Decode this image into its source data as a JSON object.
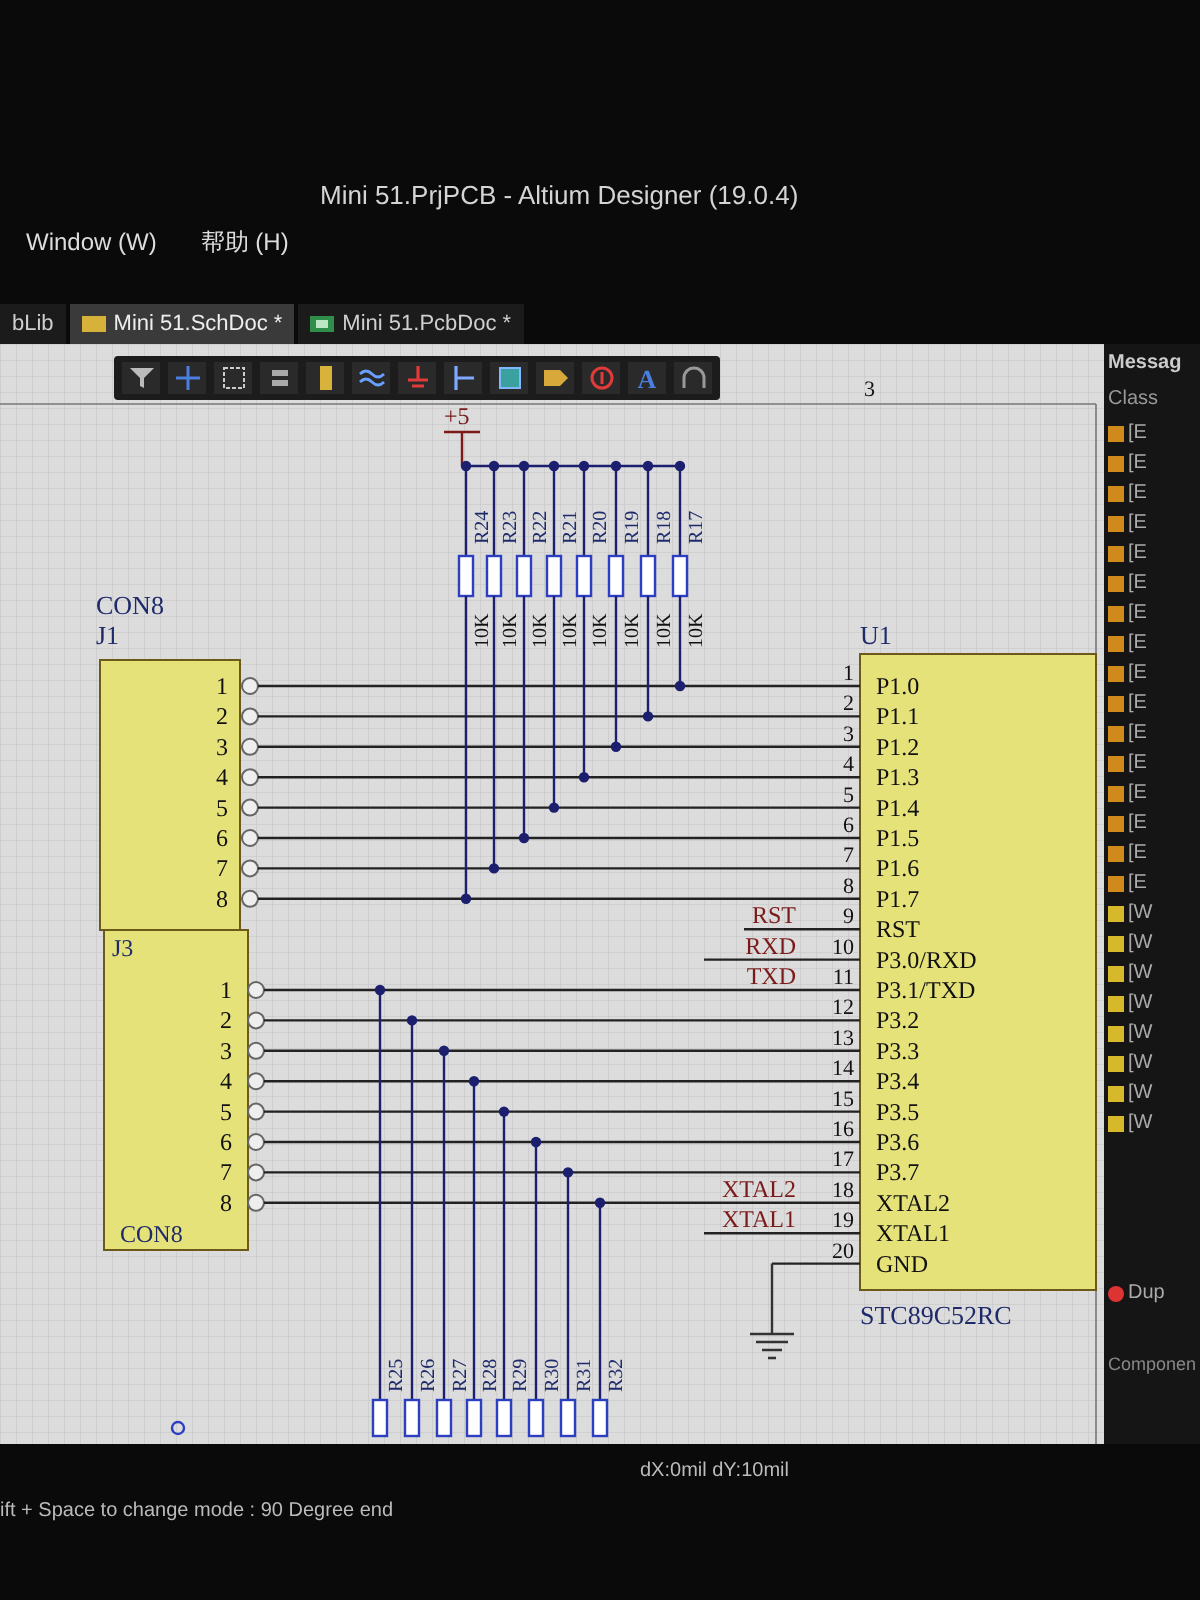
{
  "window": {
    "title": "Mini 51.PrjPCB - Altium Designer (19.0.4)"
  },
  "menu": [
    {
      "label": "Window (W)"
    },
    {
      "label": "帮助 (H)"
    }
  ],
  "tabs": [
    {
      "label": "bLib",
      "kind": "lib",
      "selected": false
    },
    {
      "label": "Mini 51.SchDoc *",
      "kind": "sch",
      "selected": true
    },
    {
      "label": "Mini 51.PcbDoc *",
      "kind": "pcb",
      "selected": false
    }
  ],
  "toolbar": [
    {
      "kind": "filter"
    },
    {
      "kind": "cross"
    },
    {
      "kind": "select"
    },
    {
      "kind": "align"
    },
    {
      "kind": "part"
    },
    {
      "kind": "bus"
    },
    {
      "kind": "power"
    },
    {
      "kind": "port"
    },
    {
      "kind": "sheet"
    },
    {
      "kind": "harness"
    },
    {
      "kind": "noerc"
    },
    {
      "kind": "text",
      "label": "A"
    },
    {
      "kind": "arc"
    }
  ],
  "schematic": {
    "zone_label": "3",
    "power_port": {
      "label": "+5"
    },
    "pullup_resistors": [
      {
        "designator": "R24",
        "value": "10K"
      },
      {
        "designator": "R23",
        "value": "10K"
      },
      {
        "designator": "R22",
        "value": "10K"
      },
      {
        "designator": "R21",
        "value": "10K"
      },
      {
        "designator": "R20",
        "value": "10K"
      },
      {
        "designator": "R19",
        "value": "10K"
      },
      {
        "designator": "R18",
        "value": "10K"
      },
      {
        "designator": "R17",
        "value": "10K"
      }
    ],
    "connector_top": {
      "comment": "CON8",
      "designator": "J1",
      "pins": [
        "1",
        "2",
        "3",
        "4",
        "5",
        "6",
        "7",
        "8"
      ]
    },
    "connector_bottom": {
      "designator": "J3",
      "comment": "CON8",
      "pins": [
        "1",
        "2",
        "3",
        "4",
        "5",
        "6",
        "7",
        "8"
      ]
    },
    "bottom_resistors": [
      {
        "designator": "R25"
      },
      {
        "designator": "R26"
      },
      {
        "designator": "R27"
      },
      {
        "designator": "R28"
      },
      {
        "designator": "R29"
      },
      {
        "designator": "R30"
      },
      {
        "designator": "R31"
      },
      {
        "designator": "R32"
      }
    ],
    "chip": {
      "designator": "U1",
      "comment": "STC89C52RC",
      "pins": [
        {
          "number": "1",
          "name": "P1.0"
        },
        {
          "number": "2",
          "name": "P1.1"
        },
        {
          "number": "3",
          "name": "P1.2"
        },
        {
          "number": "4",
          "name": "P1.3"
        },
        {
          "number": "5",
          "name": "P1.4"
        },
        {
          "number": "6",
          "name": "P1.5"
        },
        {
          "number": "7",
          "name": "P1.6"
        },
        {
          "number": "8",
          "name": "P1.7"
        },
        {
          "number": "9",
          "name": "RST",
          "net_label": "RST"
        },
        {
          "number": "10",
          "name": "P3.0/RXD",
          "net_label": "RXD"
        },
        {
          "number": "11",
          "name": "P3.1/TXD",
          "net_label": "TXD"
        },
        {
          "number": "12",
          "name": "P3.2"
        },
        {
          "number": "13",
          "name": "P3.3"
        },
        {
          "number": "14",
          "name": "P3.4"
        },
        {
          "number": "15",
          "name": "P3.5"
        },
        {
          "number": "16",
          "name": "P3.6"
        },
        {
          "number": "17",
          "name": "P3.7"
        },
        {
          "number": "18",
          "name": "XTAL2",
          "net_label": "XTAL2"
        },
        {
          "number": "19",
          "name": "XTAL1",
          "net_label": "XTAL1"
        },
        {
          "number": "20",
          "name": "GND"
        }
      ]
    }
  },
  "messages": {
    "title": "Messag",
    "column": "Class",
    "rows": [
      {
        "text": "[E",
        "color": "#d08a1c"
      },
      {
        "text": "[E",
        "color": "#d08a1c"
      },
      {
        "text": "[E",
        "color": "#d08a1c"
      },
      {
        "text": "[E",
        "color": "#d08a1c"
      },
      {
        "text": "[E",
        "color": "#d08a1c"
      },
      {
        "text": "[E",
        "color": "#d08a1c"
      },
      {
        "text": "[E",
        "color": "#d08a1c"
      },
      {
        "text": "[E",
        "color": "#d08a1c"
      },
      {
        "text": "[E",
        "color": "#d08a1c"
      },
      {
        "text": "[E",
        "color": "#d08a1c"
      },
      {
        "text": "[E",
        "color": "#d08a1c"
      },
      {
        "text": "[E",
        "color": "#d08a1c"
      },
      {
        "text": "[E",
        "color": "#d08a1c"
      },
      {
        "text": "[E",
        "color": "#d08a1c"
      },
      {
        "text": "[E",
        "color": "#d08a1c"
      },
      {
        "text": "[E",
        "color": "#d08a1c"
      },
      {
        "text": "[W",
        "color": "#d6b92a"
      },
      {
        "text": "[W",
        "color": "#d6b92a"
      },
      {
        "text": "[W",
        "color": "#d6b92a"
      },
      {
        "text": "[W",
        "color": "#d6b92a"
      },
      {
        "text": "[W",
        "color": "#d6b92a"
      },
      {
        "text": "[W",
        "color": "#d6b92a"
      },
      {
        "text": "[W",
        "color": "#d6b92a"
      },
      {
        "text": "[W",
        "color": "#d6b92a"
      }
    ],
    "details": [
      {
        "text": "Dup",
        "kind": "error"
      }
    ],
    "footer": "Componen"
  },
  "status_bar": {
    "coords": "dX:0mil dY:10mil",
    "hint": "ift + Space to change mode : 90 Degree end"
  }
}
